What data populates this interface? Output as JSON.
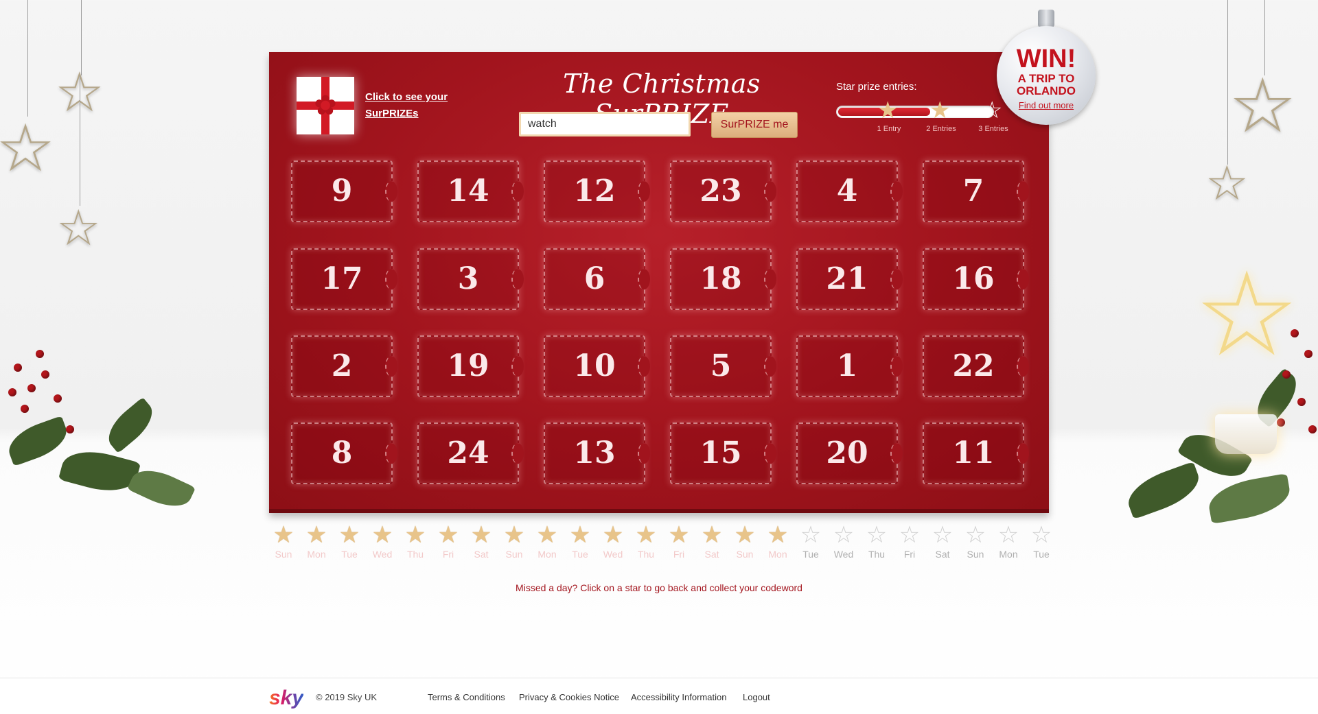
{
  "header": {
    "gift_link": "Click to see your SurPRIZEs",
    "title": "The Christmas SurPRIZE",
    "code_input_value": "watch",
    "submit_label": "SurPRIZE me"
  },
  "star_prize": {
    "label": "Star prize entries:",
    "progress_fraction": 0.6,
    "levels": [
      "1 Entry",
      "2 Entries",
      "3 Entries"
    ],
    "earned": [
      true,
      true,
      false
    ]
  },
  "promo": {
    "title": "WIN!",
    "subtitle": "A TRIP TO ORLANDO",
    "link": "Find out more"
  },
  "calendar": {
    "rows": [
      [
        "9",
        "14",
        "12",
        "23",
        "4",
        "7"
      ],
      [
        "17",
        "3",
        "6",
        "18",
        "21",
        "16"
      ],
      [
        "2",
        "19",
        "10",
        "5",
        "1",
        "22"
      ],
      [
        "8",
        "24",
        "13",
        "15",
        "20",
        "11"
      ]
    ]
  },
  "days": [
    {
      "label": "Sun",
      "active": true
    },
    {
      "label": "Mon",
      "active": true
    },
    {
      "label": "Tue",
      "active": true
    },
    {
      "label": "Wed",
      "active": true
    },
    {
      "label": "Thu",
      "active": true
    },
    {
      "label": "Fri",
      "active": true
    },
    {
      "label": "Sat",
      "active": true
    },
    {
      "label": "Sun",
      "active": true
    },
    {
      "label": "Mon",
      "active": true
    },
    {
      "label": "Tue",
      "active": true
    },
    {
      "label": "Wed",
      "active": true
    },
    {
      "label": "Thu",
      "active": true
    },
    {
      "label": "Fri",
      "active": true
    },
    {
      "label": "Sat",
      "active": true
    },
    {
      "label": "Sun",
      "active": true
    },
    {
      "label": "Mon",
      "active": true
    },
    {
      "label": "Tue",
      "active": false
    },
    {
      "label": "Wed",
      "active": false
    },
    {
      "label": "Thu",
      "active": false
    },
    {
      "label": "Fri",
      "active": false
    },
    {
      "label": "Sat",
      "active": false
    },
    {
      "label": "Sun",
      "active": false
    },
    {
      "label": "Mon",
      "active": false
    },
    {
      "label": "Tue",
      "active": false
    }
  ],
  "missed_message": "Missed a day? Click on a star to go back and collect your codeword",
  "footer": {
    "logo": "sky",
    "copyright": "© 2019 Sky UK",
    "links": [
      "Terms & Conditions",
      "Privacy & Cookies Notice",
      "Accessibility Information",
      "Logout"
    ]
  },
  "colors": {
    "board_red": "#a1141d",
    "accent_red": "#c3131e",
    "gold_star": "#e8c48a",
    "inactive_star": "#cfcfcf"
  },
  "icons": [
    "gift-icon",
    "star-icon",
    "bauble-icon",
    "sky-logo"
  ]
}
